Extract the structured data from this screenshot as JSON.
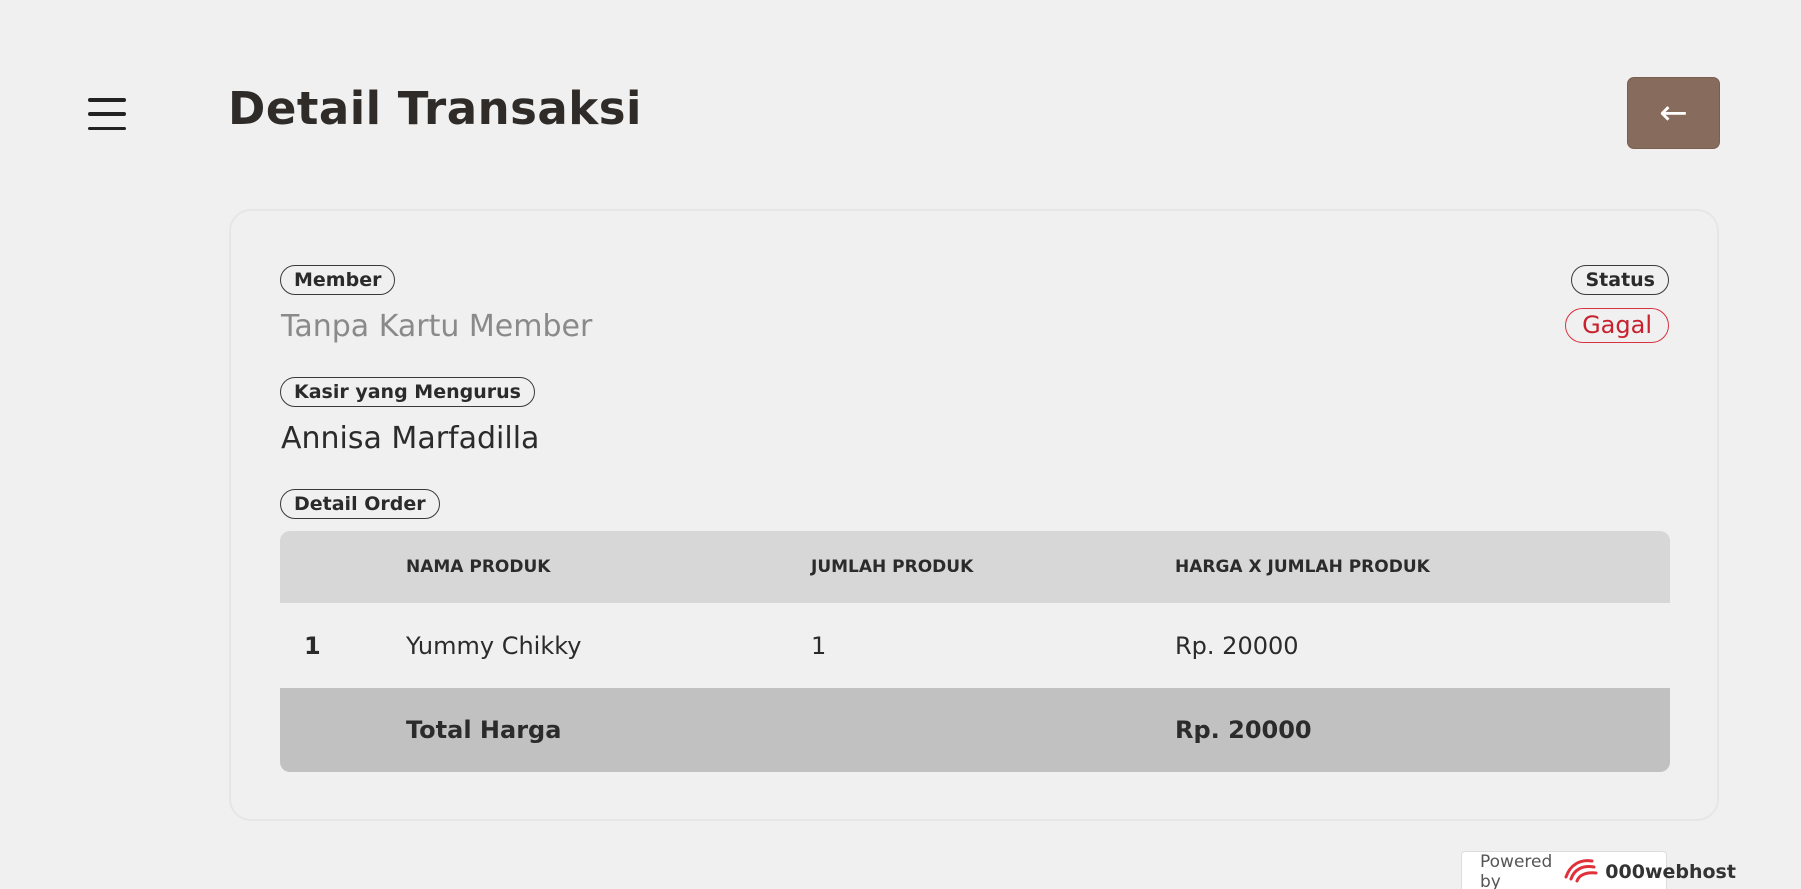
{
  "header": {
    "title": "Detail Transaksi",
    "back_icon": "←"
  },
  "member": {
    "label": "Member",
    "value": "Tanpa Kartu Member"
  },
  "status": {
    "label": "Status",
    "value": "Gagal",
    "color": "#c8202d"
  },
  "kasir": {
    "label": "Kasir yang Mengurus",
    "value": "Annisa Marfadilla"
  },
  "order": {
    "label": "Detail Order",
    "columns": [
      "",
      "NAMA PRODUK",
      "JUMLAH PRODUK",
      "HARGA X JUMLAH PRODUK"
    ],
    "rows": [
      {
        "no": "1",
        "nama": "Yummy Chikky",
        "jumlah": "1",
        "harga": "Rp. 20000"
      }
    ],
    "total_label": "Total Harga",
    "total_value": "Rp. 20000"
  },
  "footer": {
    "powered_by": "Powered by",
    "brand": "000webhost"
  },
  "colors": {
    "accent": "#876b5c",
    "background": "#f0f0f0"
  }
}
